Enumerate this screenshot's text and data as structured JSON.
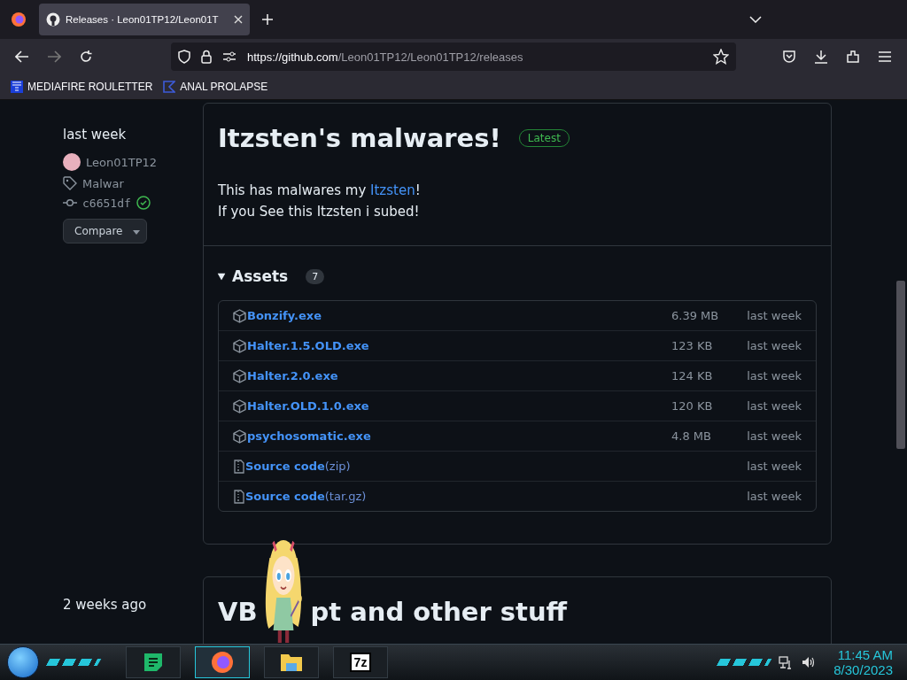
{
  "browser": {
    "tab": {
      "title": "Releases · Leon01TP12/Leon01T",
      "selected": true
    },
    "url": {
      "host": "https://github.com",
      "path": "/Leon01TP12/Leon01TP12/releases"
    },
    "bookmarks": [
      {
        "label": "MEDIAFIRE ROULETTER",
        "kind": "mediafire"
      },
      {
        "label": "ANAL PROLAPSE",
        "kind": "sigma"
      }
    ]
  },
  "releases": [
    {
      "date": "last week",
      "author": "Leon01TP12",
      "tag": "Malwar",
      "commit": "c6651df",
      "verified": true,
      "compare": "Compare",
      "title": "Itzsten's malwares!",
      "badge": "Latest",
      "body": [
        {
          "before": "This has malwares my ",
          "link": "Itzsten",
          "after": "!"
        },
        {
          "before": "If you See this Itzsten i subed!"
        }
      ],
      "assets": {
        "label": "Assets",
        "count": "7",
        "expanded": true,
        "items": [
          {
            "kind": "package",
            "name": "Bonzify.exe",
            "size": "6.39 MB",
            "date": "last week"
          },
          {
            "kind": "package",
            "name": "Halter.1.5.OLD.exe",
            "size": "123 KB",
            "date": "last week"
          },
          {
            "kind": "package",
            "name": "Halter.2.0.exe",
            "size": "124 KB",
            "date": "last week"
          },
          {
            "kind": "package",
            "name": "Halter.OLD.1.0.exe",
            "size": "120 KB",
            "date": "last week"
          },
          {
            "kind": "package",
            "name": "psychosomatic.exe",
            "size": "4.8 MB",
            "date": "last week"
          },
          {
            "kind": "source",
            "name": "Source code",
            "suffix": "(zip)",
            "date": "last week"
          },
          {
            "kind": "source",
            "name": "Source code",
            "suffix": "(tar.gz)",
            "date": "last week"
          }
        ]
      }
    },
    {
      "date": "2 weeks ago",
      "title_parts": [
        "VB",
        "pt and other stuff"
      ]
    }
  ],
  "taskbar": {
    "apps": [
      {
        "kind": "notes",
        "selected": false
      },
      {
        "kind": "browser",
        "selected": true
      },
      {
        "kind": "files",
        "selected": false
      },
      {
        "kind": "archiver",
        "label": "7z",
        "selected": false
      }
    ],
    "time": "11:45 AM",
    "date": "8/30/2023"
  }
}
